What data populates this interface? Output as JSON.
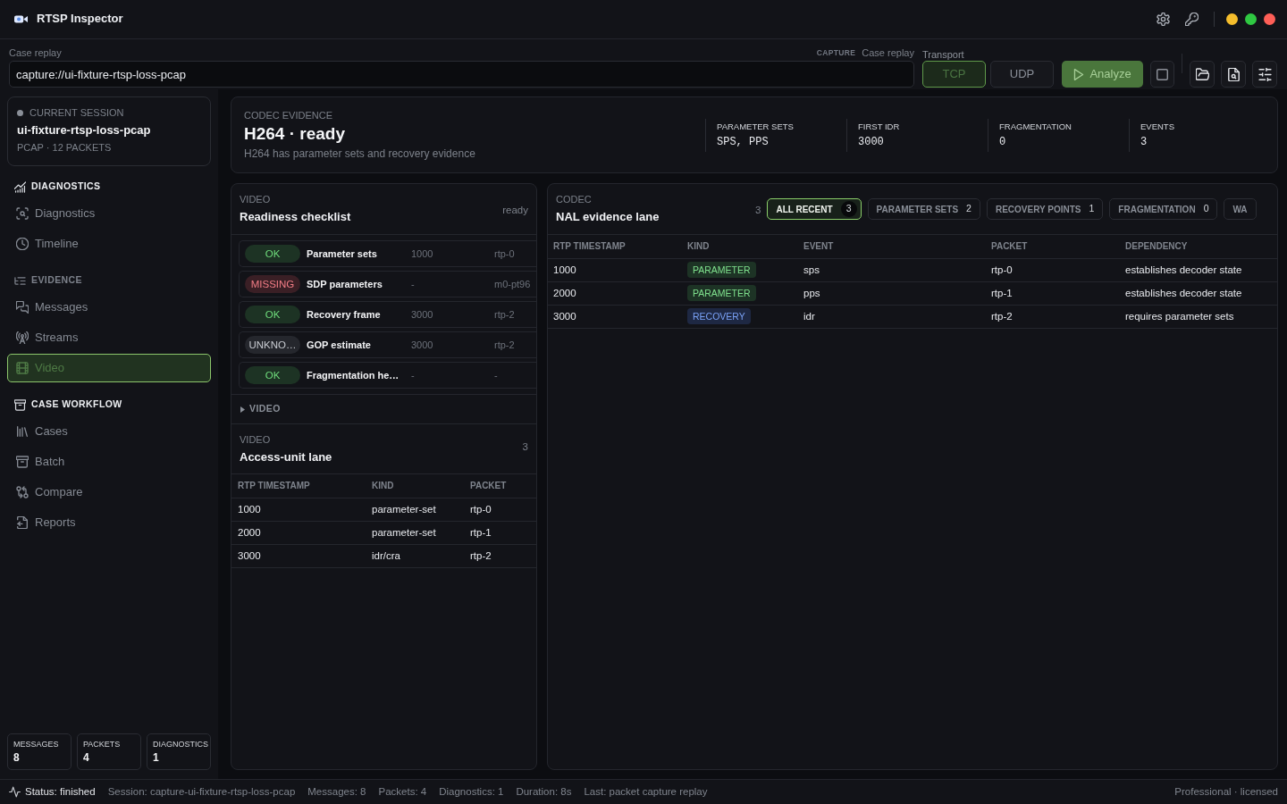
{
  "window": {
    "title": "RTSP Inspector"
  },
  "toolbar": {
    "source_label": "Case replay",
    "capture_tag": "CAPTURE",
    "capture_mode": "Case replay",
    "source_field": {
      "value": "capture://ui-fixture-rtsp-loss-pcap"
    },
    "transport_label": "Transport",
    "transport_options": [
      {
        "label": "TCP",
        "selected": true
      },
      {
        "label": "UDP",
        "selected": false
      }
    ],
    "analyze": {
      "label": "Analyze",
      "disabled": true
    }
  },
  "session": {
    "label": "CURRENT SESSION",
    "name": "ui-fixture-rtsp-loss-pcap",
    "meta": "PCAP · 12 PACKETS"
  },
  "sidebar": {
    "sections": [
      {
        "title": "DIAGNOSTICS",
        "dimmed": false,
        "items": [
          {
            "label": "Diagnostics",
            "selected": false
          },
          {
            "label": "Timeline",
            "selected": false
          }
        ]
      },
      {
        "title": "EVIDENCE",
        "dimmed": true,
        "items": [
          {
            "label": "Messages",
            "selected": false
          },
          {
            "label": "Streams",
            "selected": false
          },
          {
            "label": "Video",
            "selected": true
          }
        ]
      },
      {
        "title": "CASE WORKFLOW",
        "dimmed": false,
        "items": [
          {
            "label": "Cases",
            "selected": false
          },
          {
            "label": "Batch",
            "selected": false
          },
          {
            "label": "Compare",
            "selected": false
          },
          {
            "label": "Reports",
            "selected": false
          }
        ]
      }
    ],
    "stats": [
      {
        "label": "MESSAGES",
        "value": "8"
      },
      {
        "label": "PACKETS",
        "value": "4"
      },
      {
        "label": "DIAGNOSTICS",
        "value": "1"
      }
    ]
  },
  "codec_evidence": {
    "eyebrow": "CODEC EVIDENCE",
    "title": "H264 · ready",
    "summary": "H264 has parameter sets and recovery evidence",
    "metrics": [
      {
        "label": "PARAMETER SETS",
        "value": "SPS, PPS"
      },
      {
        "label": "FIRST IDR",
        "value": "3000"
      },
      {
        "label": "FRAGMENTATION",
        "value": "0"
      },
      {
        "label": "EVENTS",
        "value": "3"
      }
    ]
  },
  "readiness": {
    "eyebrow": "VIDEO",
    "title": "Readiness checklist",
    "state": "ready",
    "items": [
      {
        "status": "OK",
        "kind": "ok",
        "label": "Parameter sets",
        "rtp_timestamp": "1000",
        "packet": "rtp-0"
      },
      {
        "status": "MISSING",
        "kind": "missing",
        "label": "SDP parameters",
        "rtp_timestamp": "-",
        "packet": "m0-pt96"
      },
      {
        "status": "OK",
        "kind": "ok",
        "label": "Recovery frame",
        "rtp_timestamp": "3000",
        "packet": "rtp-2"
      },
      {
        "status": "UNKNO…",
        "kind": "unknown",
        "label": "GOP estimate",
        "rtp_timestamp": "3000",
        "packet": "rtp-2"
      },
      {
        "status": "OK",
        "kind": "ok",
        "label": "Fragmentation he…",
        "rtp_timestamp": "-",
        "packet": "-"
      }
    ]
  },
  "video_group": {
    "label": "VIDEO",
    "expanded": false
  },
  "access_unit_lane": {
    "eyebrow": "VIDEO",
    "title": "Access-unit lane",
    "count": "3",
    "columns": [
      "RTP TIMESTAMP",
      "KIND",
      "PACKET"
    ],
    "rows": [
      [
        "1000",
        "parameter-set",
        "rtp-0"
      ],
      [
        "2000",
        "parameter-set",
        "rtp-1"
      ],
      [
        "3000",
        "idr/cra",
        "rtp-2"
      ]
    ]
  },
  "nal_lane": {
    "eyebrow": "CODEC",
    "title": "NAL evidence lane",
    "count": "3",
    "filters": [
      {
        "label": "ALL RECENT",
        "count": "3",
        "selected": true
      },
      {
        "label": "PARAMETER SETS",
        "count": "2",
        "selected": false
      },
      {
        "label": "RECOVERY POINTS",
        "count": "1",
        "selected": false
      },
      {
        "label": "FRAGMENTATION",
        "count": "0",
        "selected": false
      },
      {
        "label": "WA",
        "selected": false
      }
    ],
    "columns": [
      "RTP TIMESTAMP",
      "KIND",
      "EVENT",
      "PACKET",
      "DEPENDENCY"
    ],
    "rows": [
      {
        "rtp_timestamp": "1000",
        "tag": {
          "label": "PARAMETER",
          "kind": "parameter"
        },
        "event": "sps",
        "packet": "rtp-0",
        "dependency": "establishes decoder state"
      },
      {
        "rtp_timestamp": "2000",
        "tag": {
          "label": "PARAMETER",
          "kind": "parameter"
        },
        "event": "pps",
        "packet": "rtp-1",
        "dependency": "establishes decoder state"
      },
      {
        "rtp_timestamp": "3000",
        "tag": {
          "label": "RECOVERY",
          "kind": "recovery"
        },
        "event": "idr",
        "packet": "rtp-2",
        "dependency": "requires parameter sets"
      }
    ]
  },
  "status_bar": {
    "status": "Status: finished",
    "fields": [
      "Session: capture-ui-fixture-rtsp-loss-pcap",
      "Messages: 8",
      "Packets: 4",
      "Diagnostics: 1",
      "Duration: 8s",
      "Last: packet capture replay"
    ],
    "license": "Professional · licensed"
  }
}
